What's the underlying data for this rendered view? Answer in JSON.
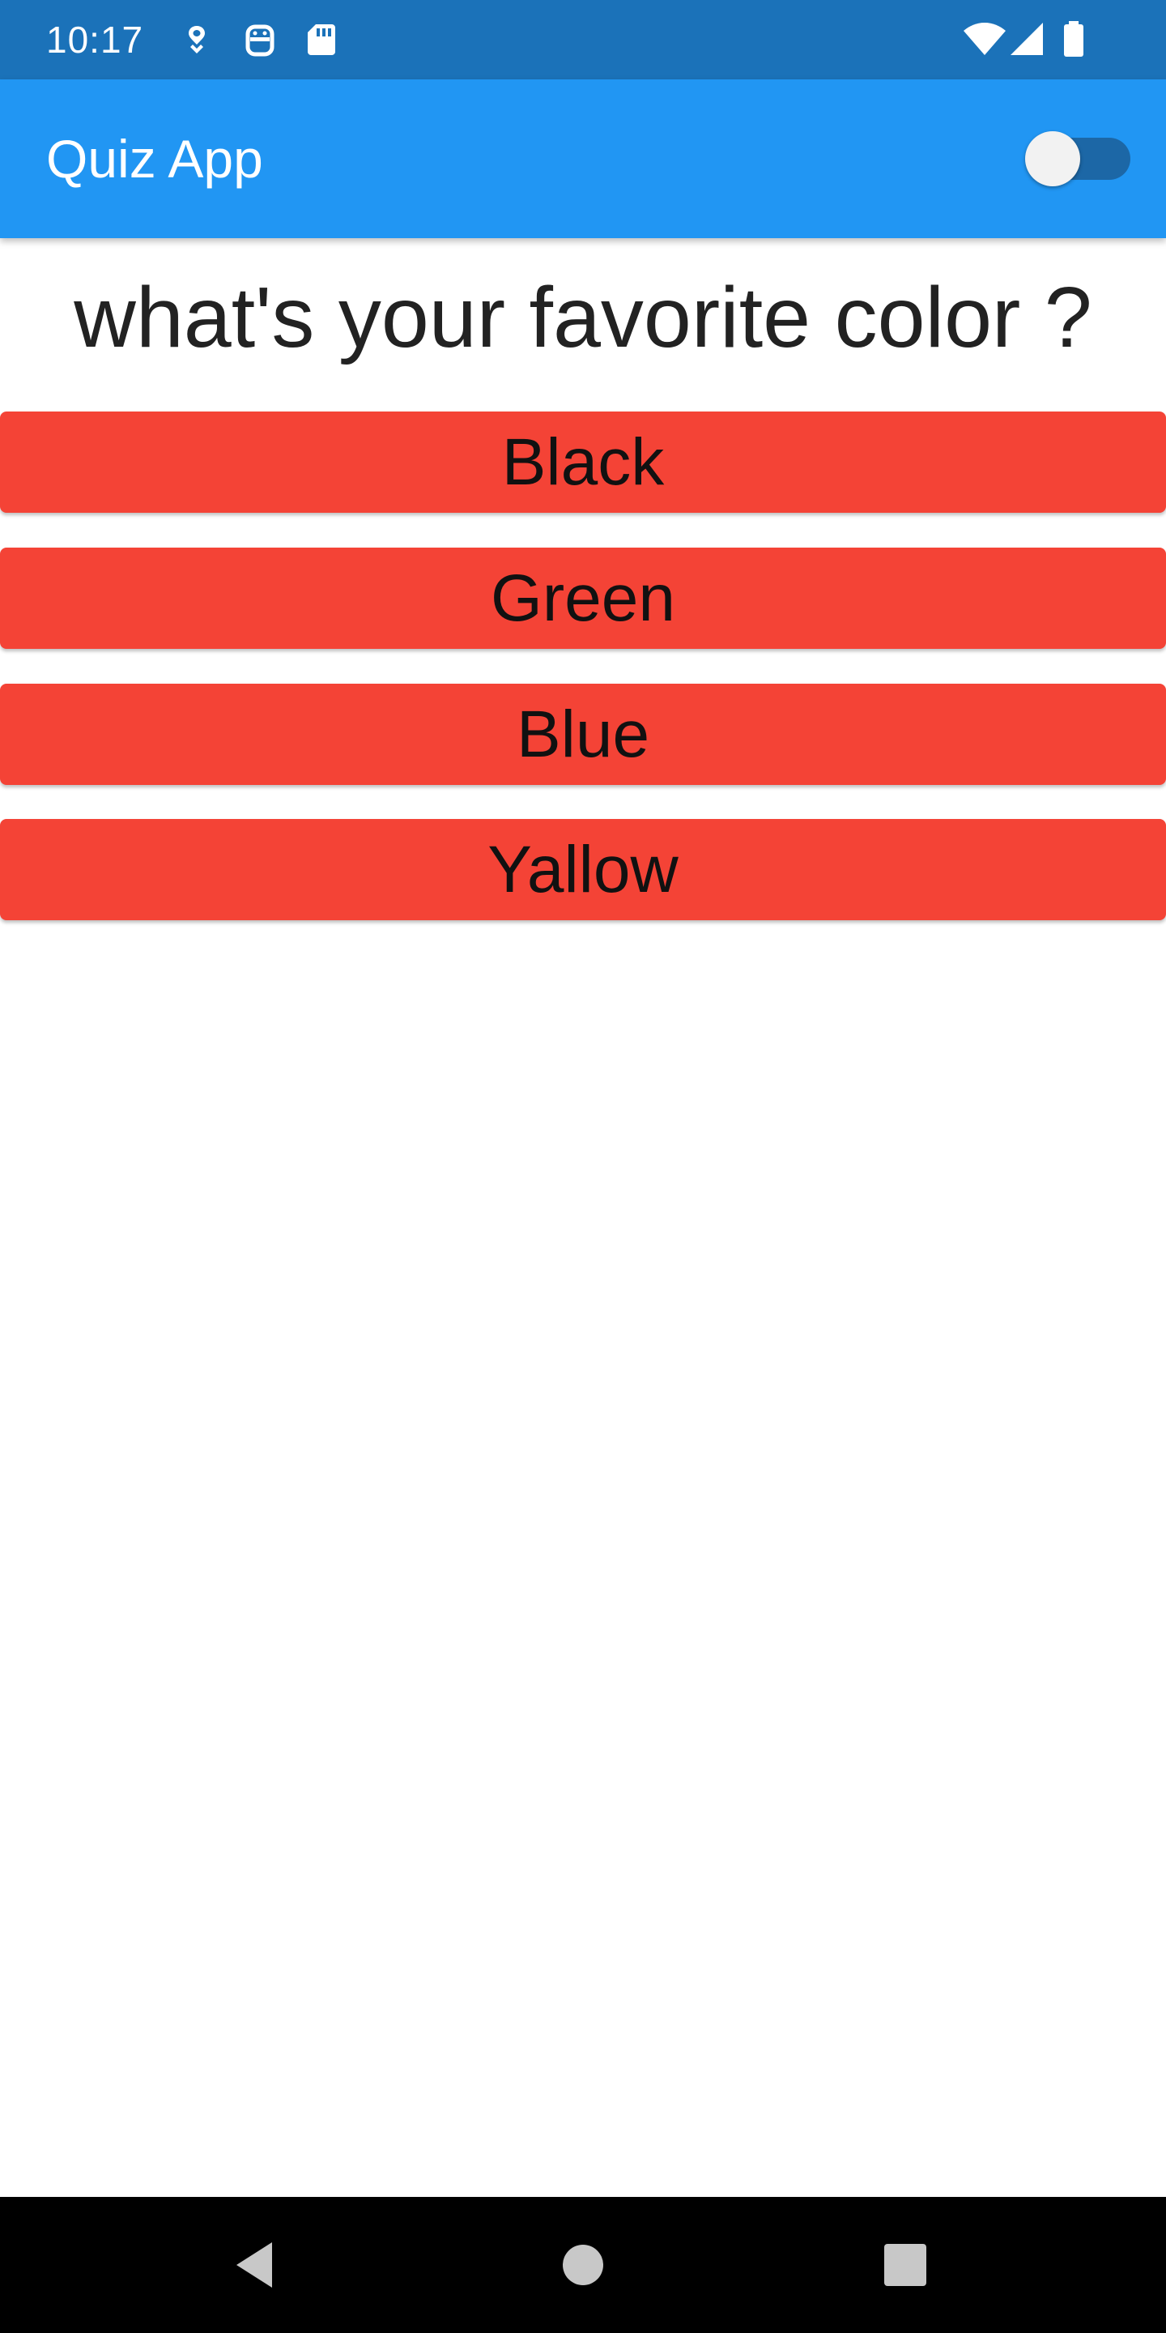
{
  "status_bar": {
    "time": "10:17",
    "left_icons": [
      "location-pin-icon",
      "android-robot-icon",
      "sd-card-icon"
    ],
    "right_icons": [
      "wifi-icon",
      "cell-signal-icon",
      "battery-icon"
    ],
    "background_color": "#1b72b9"
  },
  "app_bar": {
    "title": "Quiz App",
    "background_color": "#2196f3",
    "toggle": {
      "state": "off",
      "icon": "toggle-switch"
    }
  },
  "quiz": {
    "question": "what's your favorite color ?",
    "answers": [
      {
        "label": "Black"
      },
      {
        "label": "Green"
      },
      {
        "label": "Blue"
      },
      {
        "label": "Yallow"
      }
    ],
    "answer_button_color": "#f44336"
  },
  "nav_bar": {
    "buttons": [
      "back-icon",
      "home-icon",
      "recents-icon"
    ]
  }
}
